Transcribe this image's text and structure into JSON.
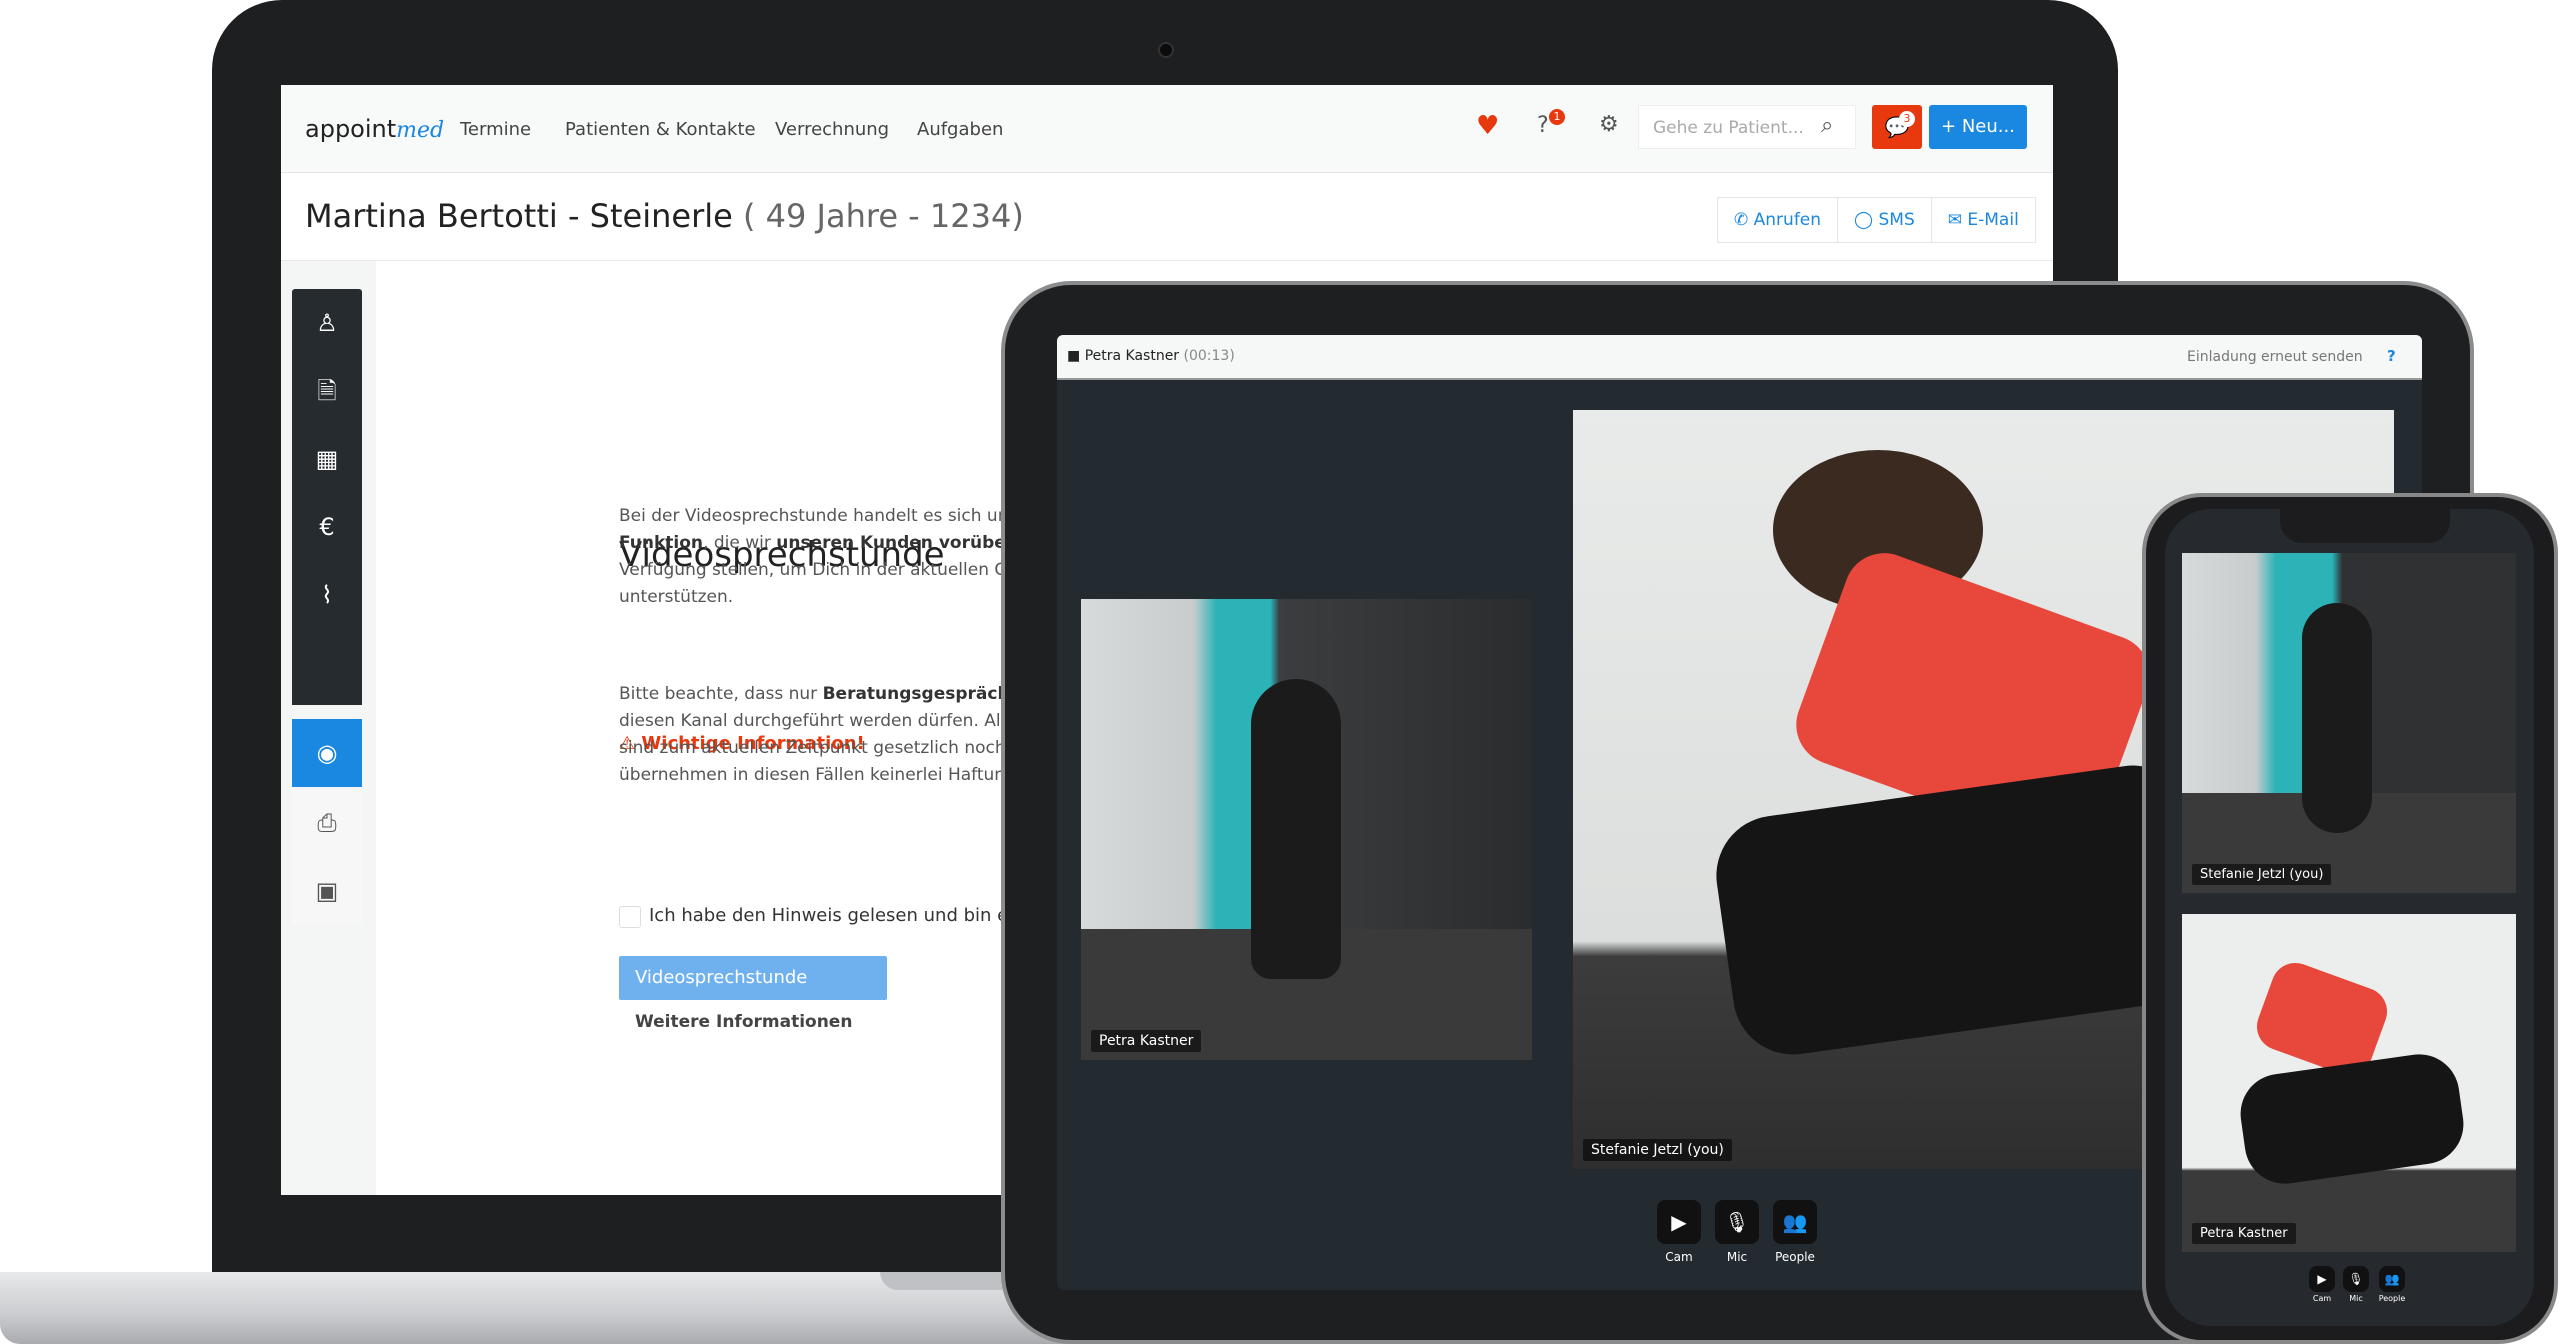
{
  "app": {
    "logo_text": "appoint",
    "logo_accent": "med",
    "brand_color": "#1a87e0",
    "alert_color": "#e8380d"
  },
  "nav": {
    "items": [
      "Termine",
      "Patienten & Kontakte",
      "Verrechnung",
      "Aufgaben"
    ],
    "help_badge": "1",
    "notify_badge": "3",
    "search_placeholder": "Gehe zu Patient...",
    "new_button": "+ Neu..."
  },
  "patient": {
    "name": "Martina Bertotti - Steinerle",
    "meta": "( 49 Jahre - 1234)",
    "actions": [
      "Anrufen",
      "SMS",
      "E-Mail"
    ]
  },
  "sidebar": {
    "icons": [
      "user-icon",
      "document-icon",
      "calendar-icon",
      "euro-icon",
      "paperclip-icon",
      "webcam-icon",
      "printer-icon",
      "qr-code-icon"
    ],
    "active": "webcam-icon"
  },
  "main": {
    "heading": "Videosprechstunde",
    "intro": [
      "Bei der Videosprechstunde handelt es sich um ei",
      "Funktion",
      ", die wir ",
      "unseren Kunden vorübergehe",
      "Verfügung stellen, um Dich in der aktuellen COVI",
      "unterstützen."
    ],
    "warning_title": "Wichtige Information!",
    "warning": [
      "Bitte beachte, dass nur ",
      "Beratungsgespräche und",
      "diesen Kanal durchgeführt werden dürfen. Alle a",
      "sind zum aktuellen Zeitpunkt gesetzlich noch nic",
      "übernehmen in diesen Fällen keinerlei Haftung."
    ],
    "checkbox_label": "Ich habe den Hinweis gelesen und bin einver",
    "checkbox_checked": false,
    "start_button": "Videosprechstunde starten...",
    "more_link": "Weitere Informationen"
  },
  "call": {
    "caller": "Petra Kastner",
    "duration": "(00:13)",
    "resend": "Einladung erneut senden",
    "help": "?",
    "tablet_videos": [
      "Petra Kastner",
      "Stefanie Jetzl (you)"
    ],
    "phone_videos": [
      "Stefanie Jetzl (you)",
      "Petra Kastner"
    ],
    "controls": [
      "Cam",
      "Mic",
      "People"
    ]
  }
}
